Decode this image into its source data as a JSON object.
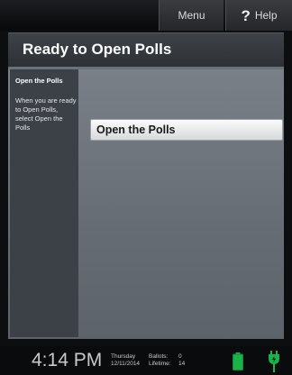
{
  "toolbar": {
    "menu_label": "Menu",
    "help_glyph": "?",
    "help_label": "Help"
  },
  "screen": {
    "title": "Ready to Open Polls"
  },
  "sidebar": {
    "heading": "Open the Polls",
    "instruction": "When you are ready to Open Polls, select Open the Polls"
  },
  "main": {
    "open_polls_button": "Open the Polls"
  },
  "status": {
    "time": "4:14 PM",
    "day": "Thursday",
    "date": "12/11/2014",
    "ballots_label": "Ballots:",
    "ballots_value": "0",
    "lifetime_label": "Lifetime:",
    "lifetime_value": "14",
    "battery_icon": "battery-full-icon",
    "power_icon": "power-plug-icon",
    "battery_color": "#19b34a",
    "power_color": "#19b34a"
  }
}
